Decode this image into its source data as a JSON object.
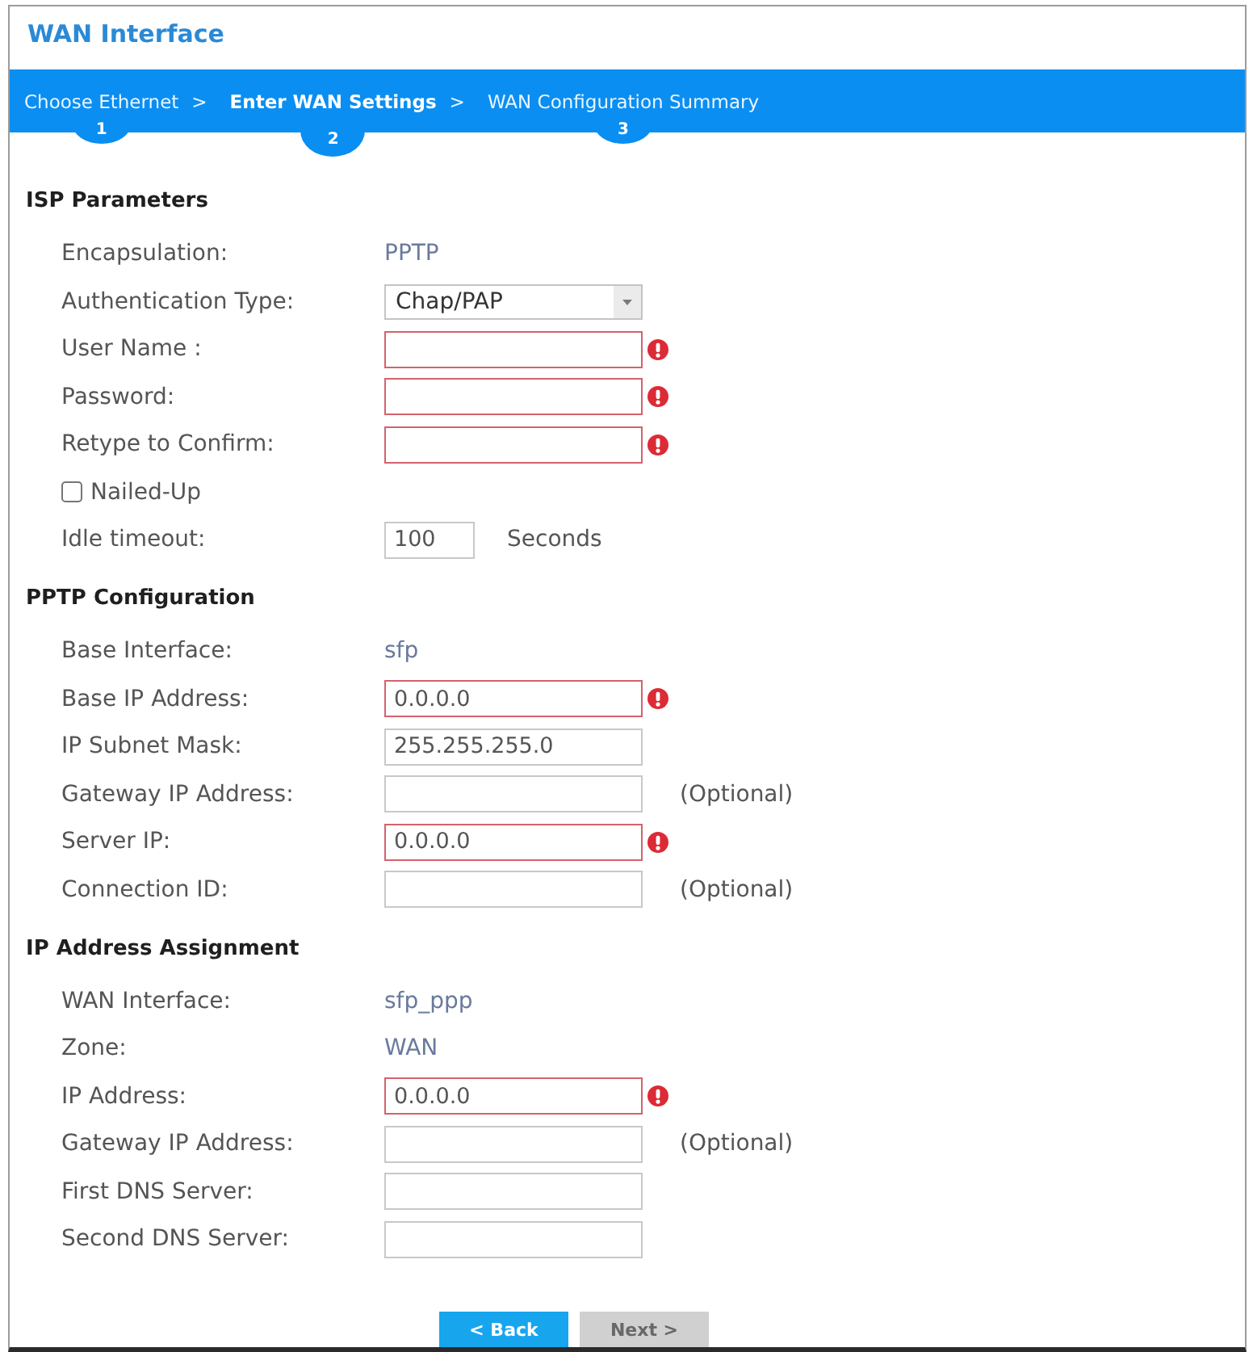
{
  "window": {
    "title": "WAN Interface"
  },
  "wizard_steps": [
    {
      "label": "Choose Ethernet",
      "number": "1",
      "selected": false,
      "separator": ">"
    },
    {
      "label": "Enter WAN Settings",
      "number": "2",
      "selected": true,
      "separator": ">"
    },
    {
      "label": "WAN Configuration Summary",
      "number": "3",
      "selected": false
    }
  ],
  "sections": [
    {
      "title": "ISP Parameters",
      "rows": [
        {
          "kind": "value",
          "label": "Encapsulation:",
          "value": "PPTP"
        },
        {
          "kind": "select",
          "label": "Authentication Type:",
          "value": "Chap/PAP"
        },
        {
          "kind": "field",
          "label": "User Name :",
          "error": true
        },
        {
          "kind": "field",
          "label": "Password:",
          "error": true
        },
        {
          "kind": "field",
          "label": "Retype to Confirm:",
          "error": true
        },
        {
          "kind": "checkbox",
          "label": "Nailed-Up",
          "checked": false
        },
        {
          "kind": "number",
          "label": "Idle timeout:",
          "value": "100",
          "unit": "Seconds",
          "error": false
        }
      ]
    },
    {
      "title": "PPTP Configuration",
      "rows": [
        {
          "kind": "value",
          "label": "Base Interface:",
          "value": "sfp"
        },
        {
          "kind": "field",
          "label": "Base IP Address:",
          "value": "0.0.0.0",
          "error": true
        },
        {
          "kind": "field",
          "label": "IP Subnet Mask:",
          "value": "255.255.255.0",
          "error": false
        },
        {
          "kind": "field",
          "label": "Gateway IP Address:",
          "error": false,
          "note": "(Optional)"
        },
        {
          "kind": "field",
          "label": "Server IP:",
          "value": "0.0.0.0",
          "error": true
        },
        {
          "kind": "field",
          "label": "Connection ID:",
          "error": false,
          "note": "(Optional)"
        }
      ]
    },
    {
      "title": "IP Address Assignment",
      "rows": [
        {
          "kind": "value",
          "label": "WAN Interface:",
          "value": "sfp_ppp"
        },
        {
          "kind": "value",
          "label": "Zone:",
          "value": "WAN"
        },
        {
          "kind": "field",
          "label": "IP Address:",
          "value": "0.0.0.0",
          "error": true
        },
        {
          "kind": "field",
          "label": "Gateway IP Address:",
          "error": false,
          "note": "(Optional)"
        },
        {
          "kind": "field",
          "label": "First DNS Server:",
          "error": false
        },
        {
          "kind": "field",
          "label": "Second DNS Server:",
          "error": false
        }
      ]
    }
  ],
  "buttons": [
    {
      "label": "< Back",
      "disabled": false
    },
    {
      "label": "Next >",
      "disabled": true
    }
  ]
}
